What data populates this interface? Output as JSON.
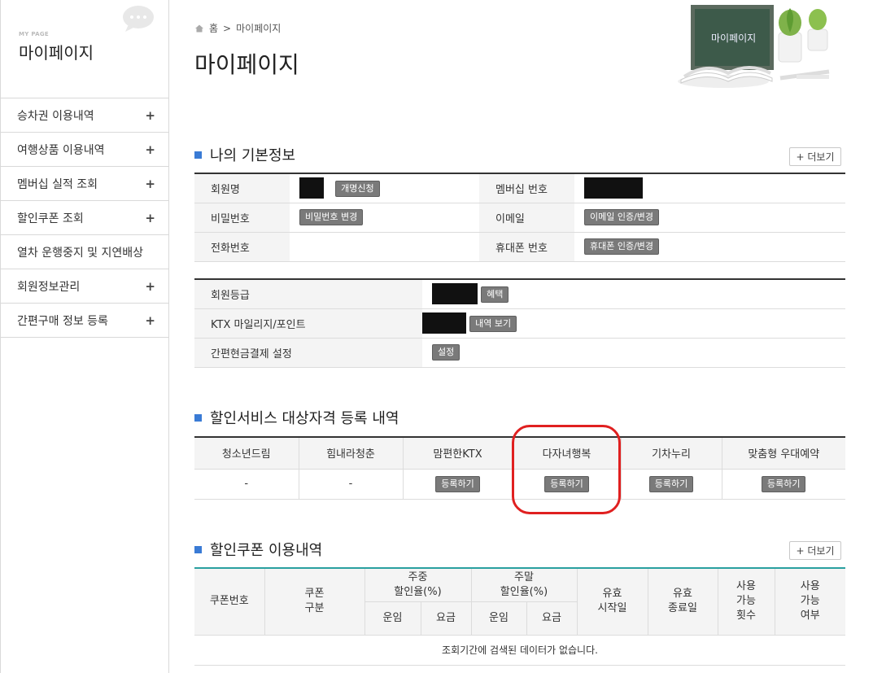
{
  "sidebar": {
    "small_label": "MY PAGE",
    "title": "마이페이지",
    "items": [
      {
        "label": "승차권 이용내역",
        "plus": "+"
      },
      {
        "label": "여행상품 이용내역",
        "plus": "+"
      },
      {
        "label": "멤버십 실적 조회",
        "plus": "+"
      },
      {
        "label": "할인쿠폰 조회",
        "plus": "+"
      },
      {
        "label": "열차 운행중지 및 지연배상",
        "plus": ""
      },
      {
        "label": "회원정보관리",
        "plus": "+"
      },
      {
        "label": "간편구매 정보 등록",
        "plus": "+"
      }
    ]
  },
  "breadcrumb": {
    "home": "홈",
    "separator": ">",
    "current": "마이페이지"
  },
  "page_title": "마이페이지",
  "hero_board_text": "마이페이지",
  "basic_info": {
    "title": "나의 기본정보",
    "more": "+ 더보기",
    "rows": [
      {
        "label1": "회원명",
        "btn1": "개명신청",
        "label2": "멤버십 번호"
      },
      {
        "label1": "비밀번호",
        "btn1": "비밀번호 변경",
        "label2": "이메일",
        "btn2": "이메일 인증/변경"
      },
      {
        "label1": "전화번호",
        "label2": "휴대폰 번호",
        "btn2": "휴대폰 인증/변경"
      }
    ],
    "grade_rows": [
      {
        "label": "회원등급",
        "btn": "혜택"
      },
      {
        "label": "KTX 마일리지/포인트",
        "btn": "내역 보기"
      },
      {
        "label": "간편현금결제 설정",
        "btn": "설정"
      }
    ]
  },
  "discount_service": {
    "title": "할인서비스 대상자격 등록 내역",
    "headers": [
      "청소년드림",
      "힘내라청춘",
      "맘편한KTX",
      "다자녀행복",
      "기차누리",
      "맞춤형 우대예약"
    ],
    "cells": [
      "-",
      "-",
      "등록하기",
      "등록하기",
      "등록하기",
      "등록하기"
    ]
  },
  "coupon": {
    "title": "할인쿠폰 이용내역",
    "more": "+ 더보기",
    "h_number": "쿠폰번호",
    "h_type": "쿠폰\n구분",
    "h_weekday": "주중\n할인율(%)",
    "h_weekend": "주말\n할인율(%)",
    "h_fare": "운임",
    "h_charge": "요금",
    "h_start": "유효\n시작일",
    "h_end": "유효\n종료일",
    "h_count": "사용\n가능\n횟수",
    "h_avail": "사용\n가능\n여부",
    "empty": "조회기간에 검색된 데이터가 없습니다."
  }
}
